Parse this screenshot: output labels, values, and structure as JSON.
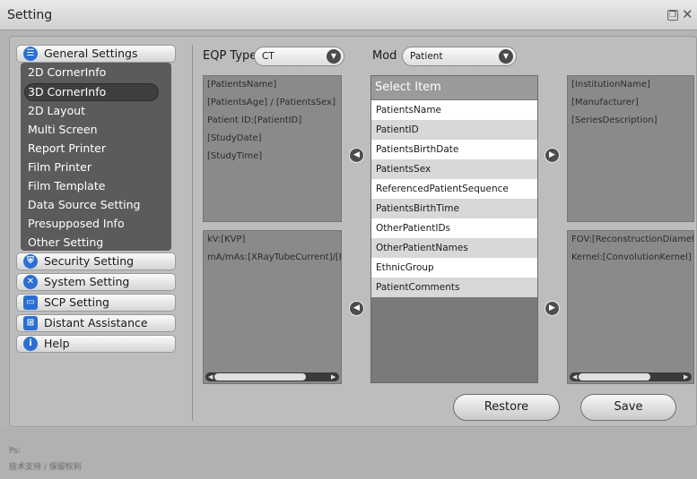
{
  "window": {
    "title": "Setting"
  },
  "sidebar": {
    "general": {
      "label": "General Settings",
      "icon": "list-icon",
      "color": "#2a6fd3"
    },
    "sub_items": [
      "2D CornerInfo",
      "3D CornerInfo",
      "2D Layout",
      "Multi Screen",
      "Report Printer",
      "Film Printer",
      "Film Template",
      "Data Source Setting",
      "Presupposed Info",
      "Other Setting"
    ],
    "selected_sub": "3D CornerInfo",
    "categories": [
      {
        "label": "Security Setting",
        "icon": "shield-icon",
        "color": "#2a6fd3"
      },
      {
        "label": "System Setting",
        "icon": "tools-icon",
        "color": "#2a6fd3"
      },
      {
        "label": "SCP Setting",
        "icon": "monitor-icon",
        "color": "#2a6fd3"
      },
      {
        "label": "Distant Assistance",
        "icon": "network-icon",
        "color": "#2a6fd3"
      },
      {
        "label": "Help",
        "icon": "info-icon",
        "color": "#2a6fd3"
      }
    ]
  },
  "controls": {
    "eqp_label": "EQP Type",
    "eqp_value": "CT",
    "mod_label": "Mod",
    "mod_value": "Patient"
  },
  "panels": {
    "top_left": [
      "[PatientsName]",
      "[PatientsAge] / [PatientsSex]",
      "Patient ID:[PatientID]",
      "[StudyDate]",
      "[StudyTime]"
    ],
    "bottom_left": [
      "kV:[KVP]",
      "mA/mAs:[XRayTubeCurrent]/[E"
    ],
    "top_right": [
      "[InstitutionName]",
      "[Manufacturer]",
      "[SeriesDescription]"
    ],
    "bottom_right": [
      "FOV:[ReconstructionDiamet",
      "Kernel:[ConvolutionKernel]"
    ]
  },
  "select": {
    "header": "Select Item",
    "items": [
      "PatientsName",
      "PatientID",
      "PatientsBirthDate",
      "PatientsSex",
      "ReferencedPatientSequence",
      "PatientsBirthTime",
      "OtherPatientIDs",
      "OtherPatientNames",
      "EthnicGroup",
      "PatientComments"
    ]
  },
  "buttons": {
    "restore": "Restore",
    "save": "Save"
  },
  "footer": {
    "line1": "Ps:",
    "line2": "技术支持 / 保留权利"
  }
}
